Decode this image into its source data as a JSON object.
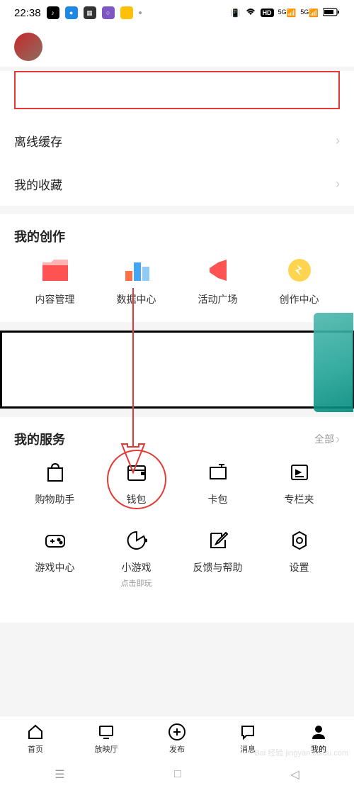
{
  "status": {
    "time": "22:38",
    "signal1": "5G",
    "signal2": "5G",
    "hd": "HD"
  },
  "section1": {
    "offline_cache": "离线缓存",
    "my_favorites": "我的收藏"
  },
  "creation": {
    "title": "我的创作",
    "tiles": [
      {
        "label": "内容管理"
      },
      {
        "label": "数据中心"
      },
      {
        "label": "活动广场"
      },
      {
        "label": "创作中心"
      }
    ]
  },
  "services": {
    "title": "我的服务",
    "more": "全部",
    "items": [
      {
        "label": "购物助手"
      },
      {
        "label": "钱包"
      },
      {
        "label": "卡包"
      },
      {
        "label": "专栏夹"
      },
      {
        "label": "游戏中心"
      },
      {
        "label": "小游戏",
        "sublabel": "点击即玩"
      },
      {
        "label": "反馈与帮助"
      },
      {
        "label": "设置"
      }
    ]
  },
  "nav": {
    "home": "首页",
    "cinema": "放映厅",
    "publish": "发布",
    "messages": "消息",
    "mine": "我的"
  },
  "watermark": "Bai 经验 jingyan.baidu.com"
}
